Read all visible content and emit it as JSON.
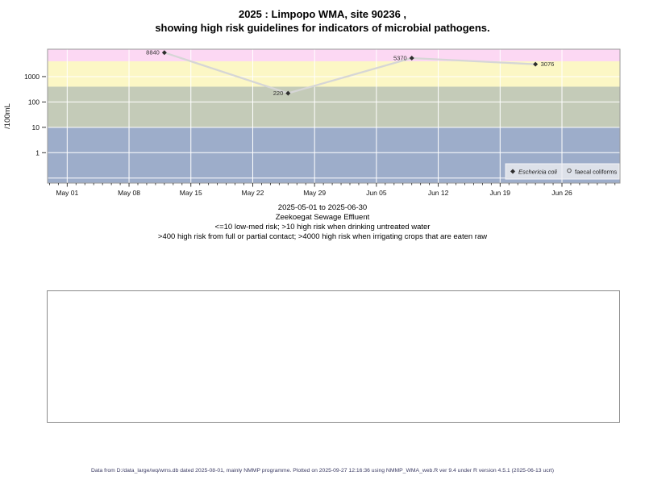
{
  "title": {
    "line1": "2025 : Limpopo WMA, site 90236 ,",
    "line2": "showing high risk guidelines for indicators of microbial pathogens."
  },
  "captions": {
    "date_range": "2025-05-01 to 2025-06-30",
    "site_name": "Zeekoegat Sewage Effluent",
    "guideline1": "<=10 low-med risk; >10 high risk when drinking untreated water",
    "guideline2": ">400 high risk from full or partial contact; >4000 high risk when irrigating crops that are eaten raw"
  },
  "footer": "Data from D:/data_large/wq/wms.db dated 2025-08-01, mainly NMMP programme. Plotted on 2025-09-27 12:16:36 using NMMP_WMA_web.R ver 9.4 under R version 4.5.1 (2025-06-13 ucrt)",
  "chart_data": {
    "type": "line",
    "title": "2025 : Limpopo WMA, site 90236 , showing high risk guidelines for indicators of microbial pathogens.",
    "xlabel": "",
    "ylabel": "/100mL",
    "y_scale": "log10",
    "y_log_range": [
      -1.2,
      4.08
    ],
    "x_day_range": [
      -2.22,
      62.57
    ],
    "x_axis_start_date": "2025-05-01",
    "grid": true,
    "y_ticks": [
      {
        "label": "1000",
        "value": 1000
      },
      {
        "label": "100",
        "value": 100
      },
      {
        "label": "10",
        "value": 10
      },
      {
        "label": "1",
        "value": 1
      }
    ],
    "y_gridlines": [
      1000,
      100,
      10,
      1,
      0.1
    ],
    "x_ticks": [
      {
        "label": "May 01",
        "day": 0
      },
      {
        "label": "May 08",
        "day": 7
      },
      {
        "label": "May 15",
        "day": 14
      },
      {
        "label": "May 22",
        "day": 21
      },
      {
        "label": "May 29",
        "day": 28
      },
      {
        "label": "Jun 05",
        "day": 35
      },
      {
        "label": "Jun 12",
        "day": 42
      },
      {
        "label": "Jun 19",
        "day": 49
      },
      {
        "label": "Jun 26",
        "day": 56
      }
    ],
    "bands": [
      {
        "name": "irrigating-raw-crops-high-risk-gt4000",
        "min": 4000,
        "max": null,
        "color": "#fcd8f3"
      },
      {
        "name": "full-partial-contact-high-risk-gt400",
        "min": 400,
        "max": 4000,
        "color": "#fcf7c5"
      },
      {
        "name": "drinking-untreated-high-risk-gt10",
        "min": 10,
        "max": 400,
        "color": "#c4cbb8"
      },
      {
        "name": "low-med-risk-le10",
        "min": null,
        "max": 10,
        "color": "#9dadca"
      }
    ],
    "series": [
      {
        "name": "Eschericia coli",
        "marker": "diamond-filled",
        "line_color": "#d6d6d6",
        "marker_color": "#2e2e2e",
        "points": [
          {
            "date": "2025-05-12",
            "day": 11,
            "value": 8840,
            "label": "8840",
            "label_side": "left"
          },
          {
            "date": "2025-05-26",
            "day": 25,
            "value": 220,
            "label": "220",
            "label_side": "left"
          },
          {
            "date": "2025-06-09",
            "day": 39,
            "value": 5370,
            "label": "5370",
            "label_side": "left"
          },
          {
            "date": "2025-06-23",
            "day": 53,
            "value": 3076,
            "label": "3076",
            "label_side": "right"
          }
        ]
      },
      {
        "name": "faecal coliforms",
        "marker": "circle-open",
        "line_color": "#d6d6d6",
        "marker_color": "#444444",
        "points": []
      }
    ],
    "legend": {
      "position": "bottom-right",
      "items": [
        {
          "label": "Eschericia coli",
          "marker": "diamond-filled",
          "italic": true
        },
        {
          "label": "faecal coliforms",
          "marker": "circle-open",
          "italic": false
        }
      ]
    },
    "colors": {
      "gridline": "#ffffff",
      "plot_border": "#999999",
      "axis_text": "#111111",
      "series_line": "#d6d6d6",
      "marker": "#2e2e2e",
      "point_label": "#333333",
      "legend_bg": "#dde1e9",
      "legend_border": "#f2f3f6"
    }
  }
}
